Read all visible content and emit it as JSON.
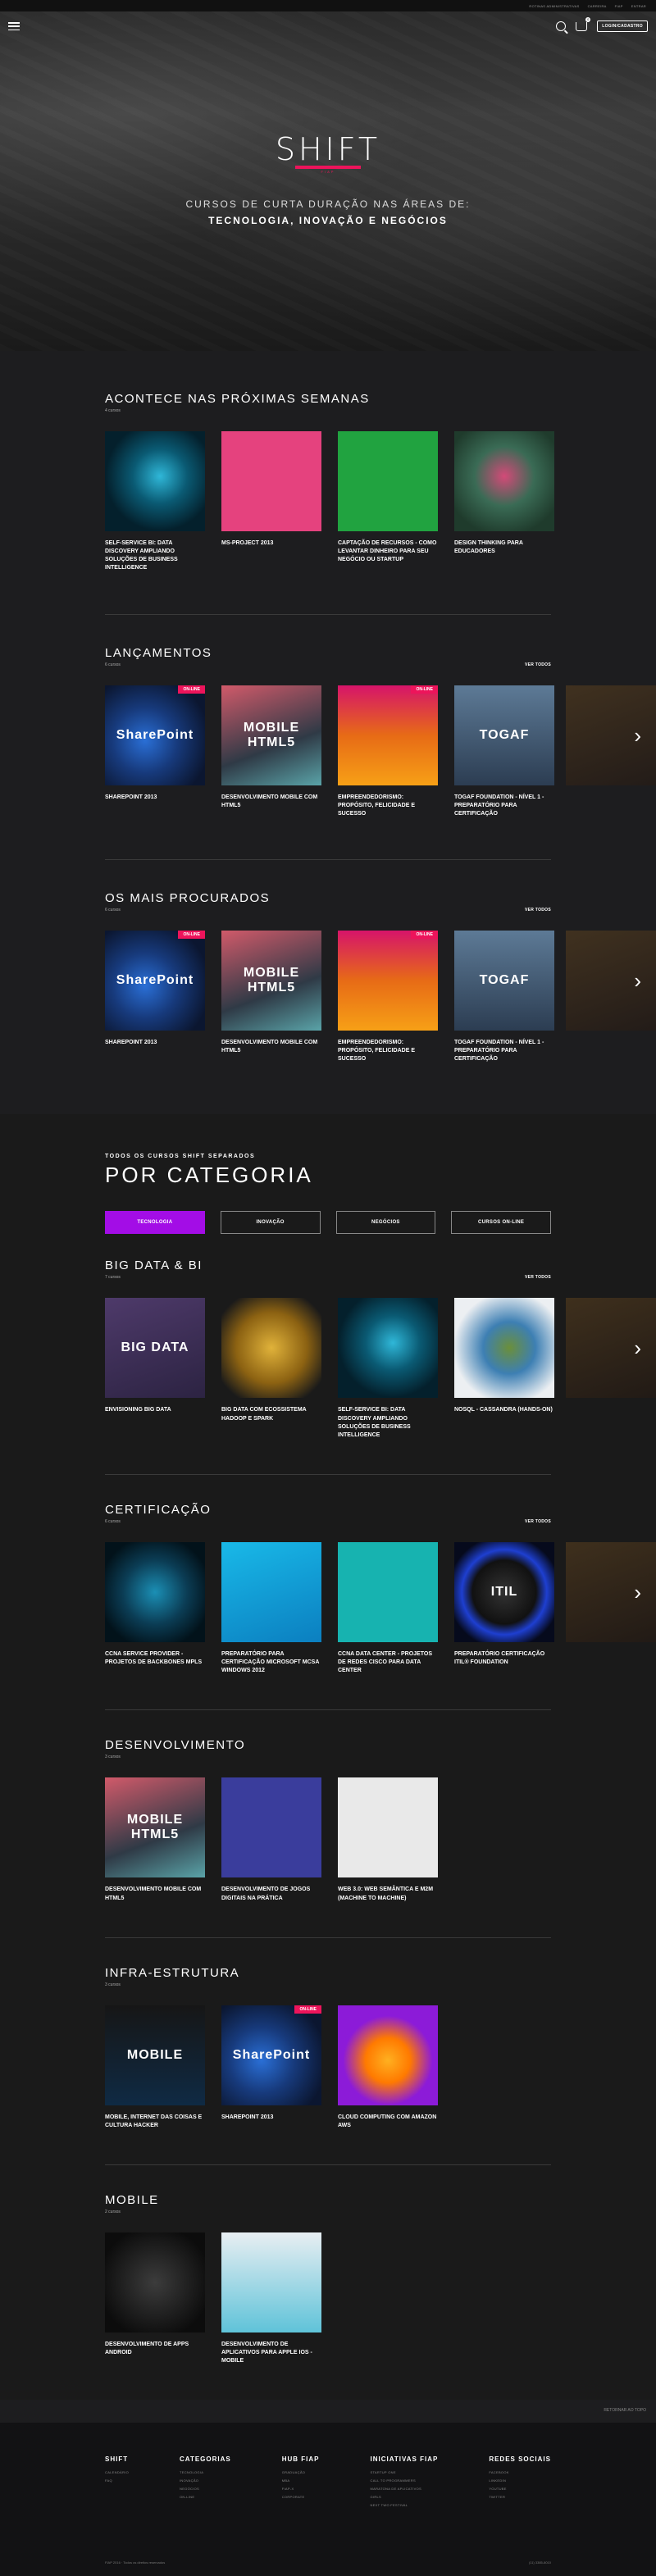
{
  "topbar": {
    "links": [
      "ROTINAS ADMINISTRATIVAS",
      "CARREIRA",
      "FIAP",
      "ENTRAR"
    ]
  },
  "nav": {
    "login_label": "LOGIN/CADASTRO",
    "cart_count": "0"
  },
  "hero": {
    "logo": "SHIFT",
    "logo_sub": "FIAP",
    "subtitle": "CURSOS DE CURTA DURAÇÃO NAS ÁREAS DE:",
    "areas": "TECNOLOGIA, INOVAÇÃO E NEGÓCIOS"
  },
  "see_all": "VER TODOS",
  "sections": [
    {
      "id": "proximas",
      "title": "ACONTECE NAS PRÓXIMAS SEMANAS",
      "count": "4 cursos",
      "see_all": false,
      "cards": [
        {
          "title": "SELF-SERVICE BI: DATA DISCOVERY AMPLIANDO SOLUÇÕES DE BUSINESS INTELLIGENCE",
          "bg": "radial-gradient(circle at 55% 45%, #2fb7d8 0%, #0a5a73 35%, #04202c 70%)",
          "label": "",
          "badge": ""
        },
        {
          "title": "MS-PROJECT 2013",
          "bg": "#e5427e",
          "label": "",
          "badge": ""
        },
        {
          "title": "CAPTAÇÃO DE RECURSOS - COMO LEVANTAR DINHEIRO PARA SEU NEGÓCIO OU STARTUP",
          "bg": "#21a340",
          "label": "",
          "badge": ""
        },
        {
          "title": "DESIGN THINKING PARA EDUCADORES",
          "bg": "radial-gradient(circle at 50% 45%, #d34a78 0%, #3a6b55 40%, #1f3b2c 80%)",
          "label": "",
          "badge": ""
        }
      ]
    },
    {
      "id": "lancamentos",
      "title": "LANÇAMENTOS",
      "count": "6 cursos",
      "see_all": true,
      "cards": [
        {
          "title": "SHAREPOINT 2013",
          "bg": "radial-gradient(circle at 40% 55%, #2a6fd6 0%, #173a7c 40%, #0b1630 80%)",
          "label": "SharePoint",
          "badge": "ON-LINE"
        },
        {
          "title": "DESENVOLVIMENTO MOBILE COM HTML5",
          "bg": "linear-gradient(160deg, #d15a6a 0%, #2f3a46 60%, #5aa3a8 100%)",
          "label": "MOBILE HTML5",
          "badge": ""
        },
        {
          "title": "EMPREENDEDORISMO: PROPÓSITO, FELICIDADE E SUCESSO",
          "bg": "linear-gradient(180deg, #d6146a 0%, #e76b16 50%, #f7a016 100%)",
          "label": "",
          "badge": "ON-LINE"
        },
        {
          "title": "TOGAF FOUNDATION - NÍVEL 1 - PREPARATÓRIO PARA CERTIFICAÇÃO",
          "bg": "linear-gradient(180deg, #5d7a96 0%, #2c3d52 100%)",
          "label": "TOGAF",
          "badge": ""
        }
      ]
    },
    {
      "id": "procurados",
      "title": "OS MAIS PROCURADOS",
      "count": "6 cursos",
      "see_all": true,
      "cards": [
        {
          "title": "SHAREPOINT 2013",
          "bg": "radial-gradient(circle at 40% 55%, #2a6fd6 0%, #173a7c 40%, #0b1630 80%)",
          "label": "SharePoint",
          "badge": "ON-LINE"
        },
        {
          "title": "DESENVOLVIMENTO MOBILE COM HTML5",
          "bg": "linear-gradient(160deg, #d15a6a 0%, #2f3a46 60%, #5aa3a8 100%)",
          "label": "MOBILE HTML5",
          "badge": ""
        },
        {
          "title": "EMPREENDEDORISMO: PROPÓSITO, FELICIDADE E SUCESSO",
          "bg": "linear-gradient(180deg, #d6146a 0%, #e76b16 50%, #f7a016 100%)",
          "label": "",
          "badge": "ON-LINE"
        },
        {
          "title": "TOGAF FOUNDATION - NÍVEL 1 - PREPARATÓRIO PARA CERTIFICAÇÃO",
          "bg": "linear-gradient(180deg, #5d7a96 0%, #2c3d52 100%)",
          "label": "TOGAF",
          "badge": ""
        }
      ]
    }
  ],
  "category": {
    "kicker": "TODOS OS CURSOS SHIFT SEPARADOS",
    "title": "POR CATEGORIA",
    "tabs": [
      "TECNOLOGIA",
      "INOVAÇÃO",
      "NEGÓCIOS",
      "CURSOS ON-LINE"
    ]
  },
  "cat_sections": [
    {
      "id": "bigdata",
      "title": "BIG DATA & BI",
      "count": "7 cursos",
      "see_all": true,
      "peek": true,
      "cards": [
        {
          "title": "ENVISIONING BIG DATA",
          "bg": "linear-gradient(160deg, #4e3a6a 0%, #2c2342 100%)",
          "label": "BIG DATA",
          "badge": ""
        },
        {
          "title": "BIG DATA COM ECOSSISTEMA HADOOP E SPARK",
          "bg": "radial-gradient(circle at 50% 50%, #e0b23a 0%, #8c6212 50%, #1a1a1a 85%)",
          "label": "",
          "badge": ""
        },
        {
          "title": "SELF-SERVICE BI: DATA DISCOVERY AMPLIANDO SOLUÇÕES DE BUSINESS INTELLIGENCE",
          "bg": "radial-gradient(circle at 55% 45%, #2fb7d8 0%, #0a5a73 35%, #04202c 70%)",
          "label": "",
          "badge": ""
        },
        {
          "title": "NOSQL - CASSANDRA (HANDS-ON)",
          "bg": "radial-gradient(circle at 55% 50%, #6b8f3a 0%, #3d7fb3 35%, #eceff2 75%)",
          "label": "",
          "badge": ""
        }
      ]
    },
    {
      "id": "certificacao",
      "title": "CERTIFICAÇÃO",
      "count": "6 cursos",
      "see_all": true,
      "peek": true,
      "cards": [
        {
          "title": "CCNA SERVICE PROVIDER - PROJETOS DE BACKBONES MPLS",
          "bg": "radial-gradient(circle at 50% 50%, #1b8fb5 0%, #0b3d55 45%, #02121a 80%)",
          "label": "",
          "badge": ""
        },
        {
          "title": "PREPARATÓRIO PARA CERTIFICAÇÃO MICROSOFT MCSA WINDOWS 2012",
          "bg": "linear-gradient(160deg, #19b9e8 0%, #0b7fc0 100%)",
          "label": "",
          "badge": ""
        },
        {
          "title": "CCNA DATA CENTER - PROJETOS DE REDES CISCO PARA DATA CENTER",
          "bg": "#17b3b0",
          "label": "",
          "badge": ""
        },
        {
          "title": "PREPARATÓRIO CERTIFICAÇÃO ITIL® FOUNDATION",
          "bg": "radial-gradient(circle at 50% 50%, #333 0%, #111 45%, #1e3fd0 60%, #060a1c 80%)",
          "label": "ITIL",
          "badge": ""
        }
      ]
    },
    {
      "id": "desenvolvimento",
      "title": "DESENVOLVIMENTO",
      "count": "3 cursos",
      "see_all": false,
      "peek": false,
      "cards": [
        {
          "title": "DESENVOLVIMENTO MOBILE COM HTML5",
          "bg": "linear-gradient(160deg, #d15a6a 0%, #2f3a46 60%, #5aa3a8 100%)",
          "label": "MOBILE HTML5",
          "badge": ""
        },
        {
          "title": "DESENVOLVIMENTO DE JOGOS DIGITAIS NA PRÁTICA",
          "bg": "#3a3d9c",
          "label": "",
          "badge": ""
        },
        {
          "title": "WEB 3.0: WEB SEMÂNTICA E M2M (MACHINE TO MACHINE)",
          "bg": "#e9e9e9",
          "label": "",
          "badge": ""
        }
      ]
    },
    {
      "id": "infra",
      "title": "INFRA-ESTRUTURA",
      "count": "3 cursos",
      "see_all": false,
      "peek": false,
      "cards": [
        {
          "title": "MOBILE, INTERNET DAS COISAS E CULTURA HACKER",
          "bg": "linear-gradient(180deg, #161616 0%, #0f2a44 100%)",
          "label": "MOBILE",
          "badge": ""
        },
        {
          "title": "SHAREPOINT 2013",
          "bg": "radial-gradient(circle at 40% 55%, #2a6fd6 0%, #173a7c 40%, #0b1630 80%)",
          "label": "SharePoint",
          "badge": "ON-LINE"
        },
        {
          "title": "CLOUD COMPUTING COM AMAZON AWS",
          "bg": "radial-gradient(circle at 50% 55%, #ffb020 0%, #ff7a00 30%, #8c1bd8 60%)",
          "label": "",
          "badge": ""
        }
      ]
    },
    {
      "id": "mobile",
      "title": "MOBILE",
      "count": "2 cursos",
      "see_all": false,
      "peek": false,
      "cards": [
        {
          "title": "DESENVOLVIMENTO DE APPS ANDROID",
          "bg": "radial-gradient(circle at 50% 50%, #3c3c3c 0%, #0c0c0c 80%)",
          "label": "",
          "badge": ""
        },
        {
          "title": "DESENVOLVIMENTO DE APLICATIVOS PARA APPLE IOS - MOBILE",
          "bg": "linear-gradient(180deg, #e8eef2 0%, #5fc3d9 100%)",
          "label": "",
          "badge": ""
        }
      ]
    }
  ],
  "back_to_top": "RETORNAR AO TOPO",
  "footer": {
    "cols": [
      {
        "title": "SHIFT",
        "items": [
          "CALENDÁRIO",
          "FAQ"
        ]
      },
      {
        "title": "CATEGORIAS",
        "items": [
          "TECNOLOGIA",
          "INOVAÇÃO",
          "NEGÓCIOS",
          "ON-LINE"
        ]
      },
      {
        "title": "HUB FIAP",
        "items": [
          "GRADUAÇÃO",
          "MBA",
          "FIAP-X",
          "CORPORATE"
        ]
      },
      {
        "title": "INICIATIVAS FIAP",
        "items": [
          "STARTUP ONE",
          "CALL TO PROGRAMMERS",
          "MARATONA DE APLICATIVOS",
          "GIRLS",
          "NEXT TWO FESTIVAL"
        ]
      },
      {
        "title": "REDES SOCIAIS",
        "items": [
          "FACEBOOK",
          "LINKEDIN",
          "YOUTUBE",
          "TWITTER"
        ]
      }
    ],
    "copyright": "FIAP 2016 · Todos os direitos reservados",
    "phone": "(11) 3385-8010"
  }
}
